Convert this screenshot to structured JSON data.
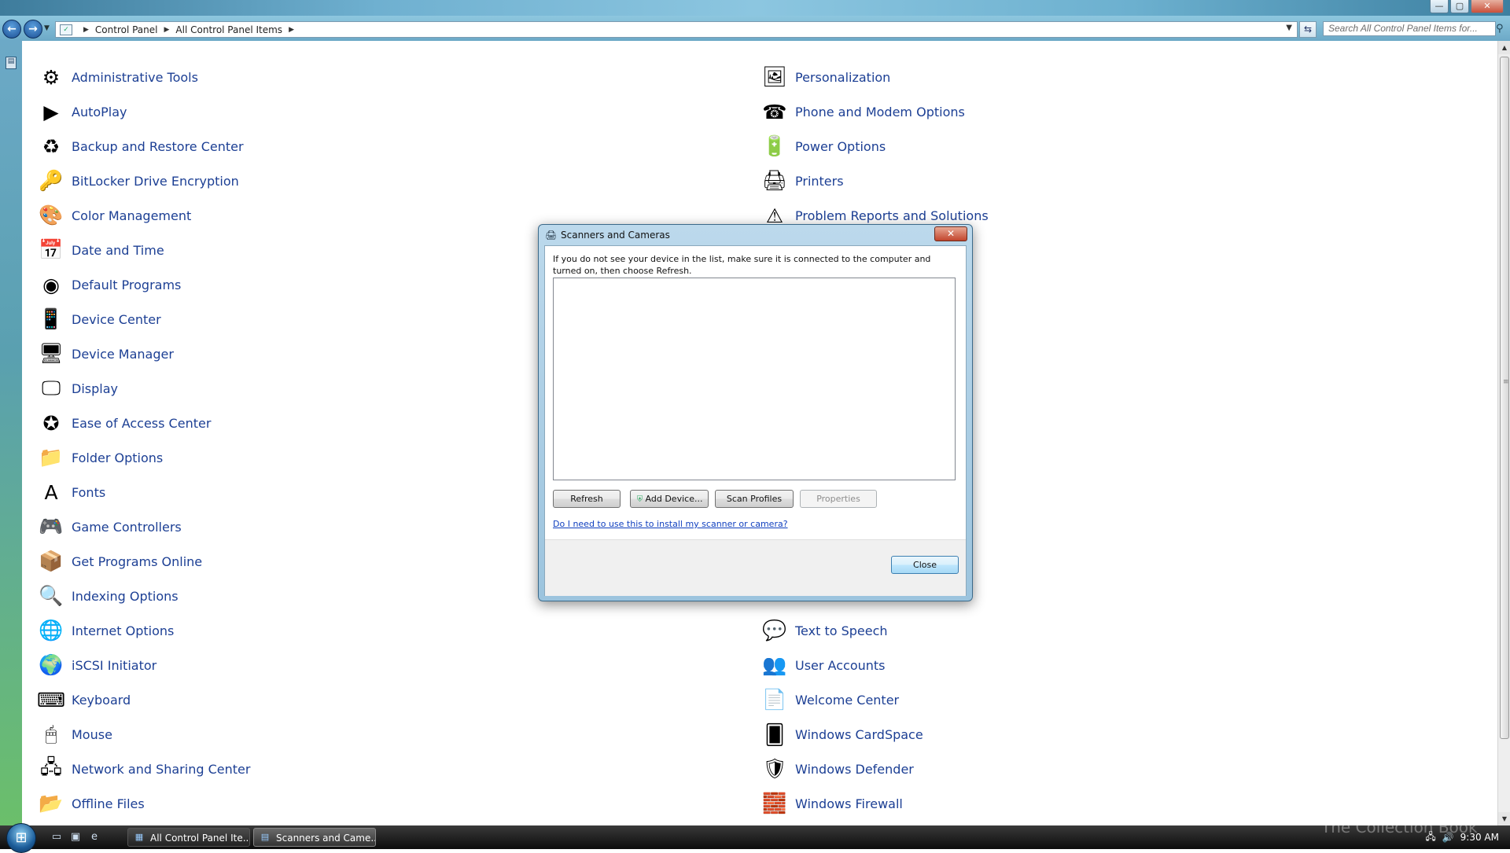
{
  "window": {
    "minimize": "—",
    "maximize": "▢",
    "close": "✕"
  },
  "address": {
    "crumbs": [
      "Control Panel",
      "All Control Panel Items"
    ],
    "search_placeholder": "Search All Control Panel Items for..."
  },
  "left_items": [
    {
      "label": "Administrative Tools",
      "icon": "admin-tools-icon",
      "glyph": "⚙"
    },
    {
      "label": "AutoPlay",
      "icon": "autoplay-icon",
      "glyph": "▶"
    },
    {
      "label": "Backup and Restore Center",
      "icon": "backup-icon",
      "glyph": "♻"
    },
    {
      "label": "BitLocker Drive Encryption",
      "icon": "bitlocker-icon",
      "glyph": "🔑"
    },
    {
      "label": "Color Management",
      "icon": "color-management-icon",
      "glyph": "🎨"
    },
    {
      "label": "Date and Time",
      "icon": "date-time-icon",
      "glyph": "📅"
    },
    {
      "label": "Default Programs",
      "icon": "default-programs-icon",
      "glyph": "◉"
    },
    {
      "label": "Device Center",
      "icon": "device-center-icon",
      "glyph": "📱"
    },
    {
      "label": "Device Manager",
      "icon": "device-manager-icon",
      "glyph": "🖥"
    },
    {
      "label": "Display",
      "icon": "display-icon",
      "glyph": "🖵"
    },
    {
      "label": "Ease of Access Center",
      "icon": "ease-of-access-icon",
      "glyph": "✪"
    },
    {
      "label": "Folder Options",
      "icon": "folder-options-icon",
      "glyph": "📁"
    },
    {
      "label": "Fonts",
      "icon": "fonts-icon",
      "glyph": "A"
    },
    {
      "label": "Game Controllers",
      "icon": "game-controllers-icon",
      "glyph": "🎮"
    },
    {
      "label": "Get Programs Online",
      "icon": "get-programs-icon",
      "glyph": "📦"
    },
    {
      "label": "Indexing Options",
      "icon": "indexing-icon",
      "glyph": "🔍"
    },
    {
      "label": "Internet Options",
      "icon": "internet-options-icon",
      "glyph": "🌐"
    },
    {
      "label": "iSCSI Initiator",
      "icon": "iscsi-icon",
      "glyph": "🌍"
    },
    {
      "label": "Keyboard",
      "icon": "keyboard-icon",
      "glyph": "⌨"
    },
    {
      "label": "Mouse",
      "icon": "mouse-icon",
      "glyph": "🖱"
    },
    {
      "label": "Network and Sharing Center",
      "icon": "network-icon",
      "glyph": "🖧"
    },
    {
      "label": "Offline Files",
      "icon": "offline-files-icon",
      "glyph": "📂"
    }
  ],
  "right_items": [
    {
      "label": "Personalization",
      "icon": "personalization-icon",
      "glyph": "🖼"
    },
    {
      "label": "Phone and Modem Options",
      "icon": "phone-modem-icon",
      "glyph": "☎"
    },
    {
      "label": "Power Options",
      "icon": "power-options-icon",
      "glyph": "🔋"
    },
    {
      "label": "Printers",
      "icon": "printers-icon",
      "glyph": "🖨"
    },
    {
      "label": "Problem Reports and Solutions",
      "icon": "problem-reports-icon",
      "glyph": "⚠"
    }
  ],
  "right_items_bottom": [
    {
      "label": "Text to Speech",
      "icon": "text-to-speech-icon",
      "glyph": "💬"
    },
    {
      "label": "User Accounts",
      "icon": "user-accounts-icon",
      "glyph": "👥"
    },
    {
      "label": "Welcome Center",
      "icon": "welcome-center-icon",
      "glyph": "📄"
    },
    {
      "label": "Windows CardSpace",
      "icon": "cardspace-icon",
      "glyph": "🂠"
    },
    {
      "label": "Windows Defender",
      "icon": "defender-icon",
      "glyph": "🛡"
    },
    {
      "label": "Windows Firewall",
      "icon": "firewall-icon",
      "glyph": "🧱"
    }
  ],
  "dialog": {
    "title": "Scanners and Cameras",
    "message": "If you do not see your device in the list, make sure it is connected to the computer and turned on, then choose Refresh.",
    "buttons": {
      "refresh": "Refresh",
      "add_device": "Add Device...",
      "scan_profiles": "Scan Profiles",
      "properties": "Properties"
    },
    "help_link": "Do I need to use this to install my scanner or camera?",
    "close": "Close"
  },
  "taskbar": {
    "buttons": [
      {
        "label": "All Control Panel Ite..."
      },
      {
        "label": "Scanners and Came..."
      }
    ],
    "time": "9:30 AM"
  },
  "watermark": "The Collection Book"
}
